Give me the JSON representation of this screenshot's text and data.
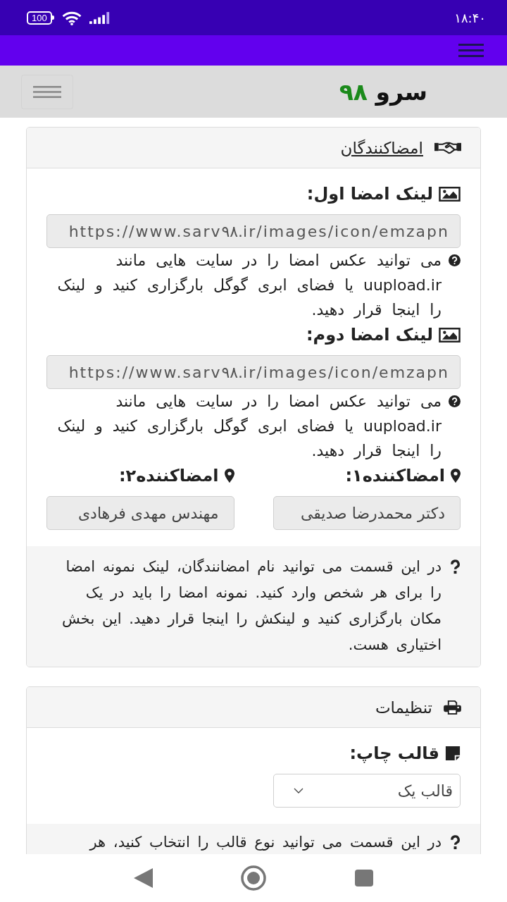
{
  "status_bar": {
    "time": "۱۸:۴۰",
    "battery": "100"
  },
  "site_header": {
    "logo": {
      "name": "سرو",
      "number": "۹۸"
    }
  },
  "signers_card": {
    "title": "امضاکنندگان",
    "links": [
      {
        "label": "لینک امضا اول:",
        "value": "https://www.sarv۹۸.ir/images/icon/emzapn",
        "readonly": true,
        "help": "می توانید عکس امضا را در سایت هایی مانند uupload.ir یا فضای ابری گوگل بارگزاری کنید و لینک را اینجا قرار دهید."
      },
      {
        "label": "لینک امضا دوم:",
        "value": "https://www.sarv۹۸.ir/images/icon/emzapn",
        "readonly": true,
        "help": "می توانید عکس امضا را در سایت هایی مانند uupload.ir یا فضای ابری گوگل بارگزاری کنید و لینک را اینجا قرار دهید."
      }
    ],
    "signers": [
      {
        "label": "امضاکننده۱:",
        "value": "دکتر محمدرضا صدیقی",
        "readonly": true
      },
      {
        "label": "امضاکننده۲:",
        "value": "مهندس مهدی فرهادی",
        "readonly": true
      }
    ],
    "note": "در این قسمت می توانید نام امضانندگان، لینک نمونه امضا را برای هر شخص وارد کنید. نمونه امضا را باید در یک مکان بارگزاری کنید و لینکش را اینجا قرار دهید. این بخش اختیاری هست."
  },
  "settings_card": {
    "title": "تنظیمات",
    "template": {
      "label": "قالب چاپ:",
      "value": "قالب یک"
    },
    "note": "در این قسمت می توانید نوع قالب را انتخاب کنید، هر"
  }
}
